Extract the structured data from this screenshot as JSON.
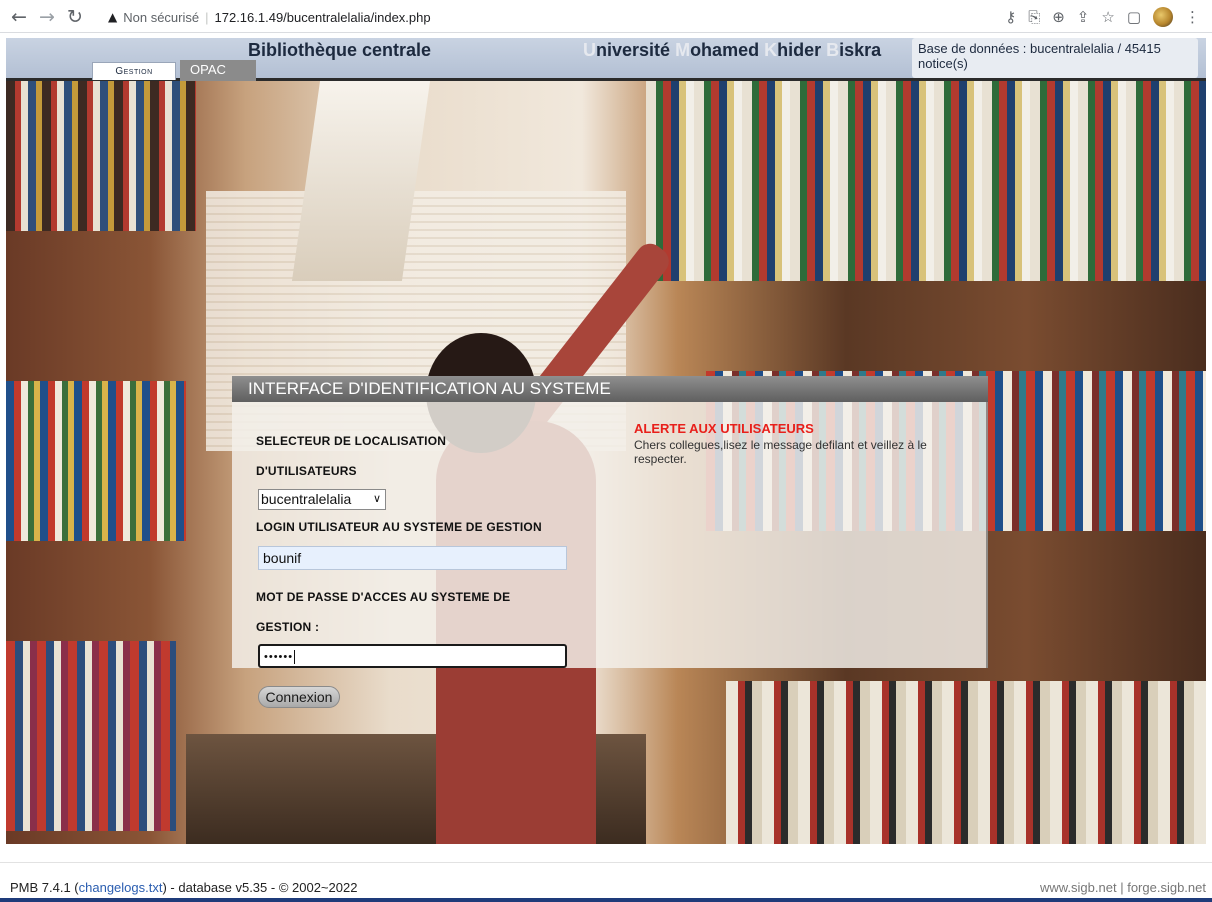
{
  "browser": {
    "security_label": "Non sécurisé",
    "separator": "|",
    "url": "172.16.1.49/bucentralelalia/index.php"
  },
  "header": {
    "title_left": "Bibliothèque centrale",
    "university": {
      "parts": [
        {
          "cap": "U",
          "rest": "niversité"
        },
        {
          "cap": "M",
          "rest": "ohamed"
        },
        {
          "cap": "K",
          "rest": "hider"
        },
        {
          "cap": "B",
          "rest": "iskra"
        }
      ]
    },
    "tabs": {
      "gestion": "Gestion",
      "opac": "OPAC"
    },
    "db_info": "Base de données : bucentralelalia / 45415 notice(s)"
  },
  "login": {
    "panel_title": "INTERFACE D'IDENTIFICATION AU SYSTEME",
    "location_label_line1": "SELECTEUR DE LOCALISATION",
    "location_label_line2": "D'UTILISATEURS",
    "location_value": "bucentralelalia",
    "login_label": "LOGIN UTILISATEUR AU SYSTEME DE GESTION",
    "login_value": "bounif",
    "password_label_line1": "MOT DE PASSE D'ACCES AU SYSTEME DE",
    "password_label_line2": "GESTION :",
    "password_mask": "••••••",
    "submit_label": "Connexion"
  },
  "alert": {
    "title": "ALERTE AUX UTILISATEURS",
    "message": "Chers collegues,lisez le message defilant et veillez à le respecter."
  },
  "footer": {
    "version": "PMB 7.4.1 (",
    "changelog_link": "changelogs.txt",
    "version_rest": ") - database v5.35 - © 2002~2022",
    "link_sigb": "www.sigb.net",
    "link_sep": "|",
    "link_forge": "forge.sigb.net"
  },
  "colors": {
    "alert_red": "#e8201b",
    "header_blue": "#b3c0d4"
  }
}
